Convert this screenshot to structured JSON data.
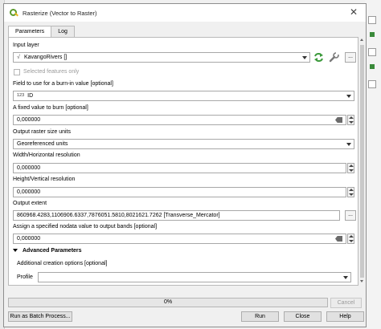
{
  "window": {
    "title": "Rasterize (Vector to Raster)"
  },
  "tabs": [
    {
      "label": "Parameters",
      "active": true
    },
    {
      "label": "Log",
      "active": false
    }
  ],
  "params": {
    "input_layer_label": "Input layer",
    "input_layer_value": "KavangoRivers []",
    "selected_features_label": "Selected features only",
    "burn_field_label": "Field to use for a burn-in value [optional]",
    "burn_field_type": "123",
    "burn_field_value": "ID",
    "fixed_value_label": "A fixed value to burn [optional]",
    "fixed_value": "0,000000",
    "units_label": "Output raster size units",
    "units_value": "Georeferenced units",
    "width_label": "Width/Horizontal resolution",
    "width_value": "0,000000",
    "height_label": "Height/Vertical resolution",
    "height_value": "0,000000",
    "extent_label": "Output extent",
    "extent_value": "860968.4283,1106906.6337,7876051.5810,8021621.7262 [Transverse_Mercator]",
    "nodata_label": "Assign a specified nodata value to output bands [optional]",
    "nodata_value": "0,000000",
    "advanced_label": "Advanced Parameters",
    "creation_options_label": "Additional creation options [optional]",
    "profile_label": "Profile",
    "profile_value": "",
    "ellipsis": "..."
  },
  "footer": {
    "progress_text": "0%",
    "progress_value": 0,
    "cancel_label": "Cancel",
    "batch_label": "Run as Batch Process...",
    "run_label": "Run",
    "close_label": "Close",
    "help_label": "Help"
  },
  "icons": {
    "app": "qgis-icon",
    "iterate": "iterate-icon",
    "settings": "wrench-icon",
    "clear": "clear-icon"
  },
  "colors": {
    "accent_green": "#5a9a2c",
    "progress_green": "#06b025"
  }
}
